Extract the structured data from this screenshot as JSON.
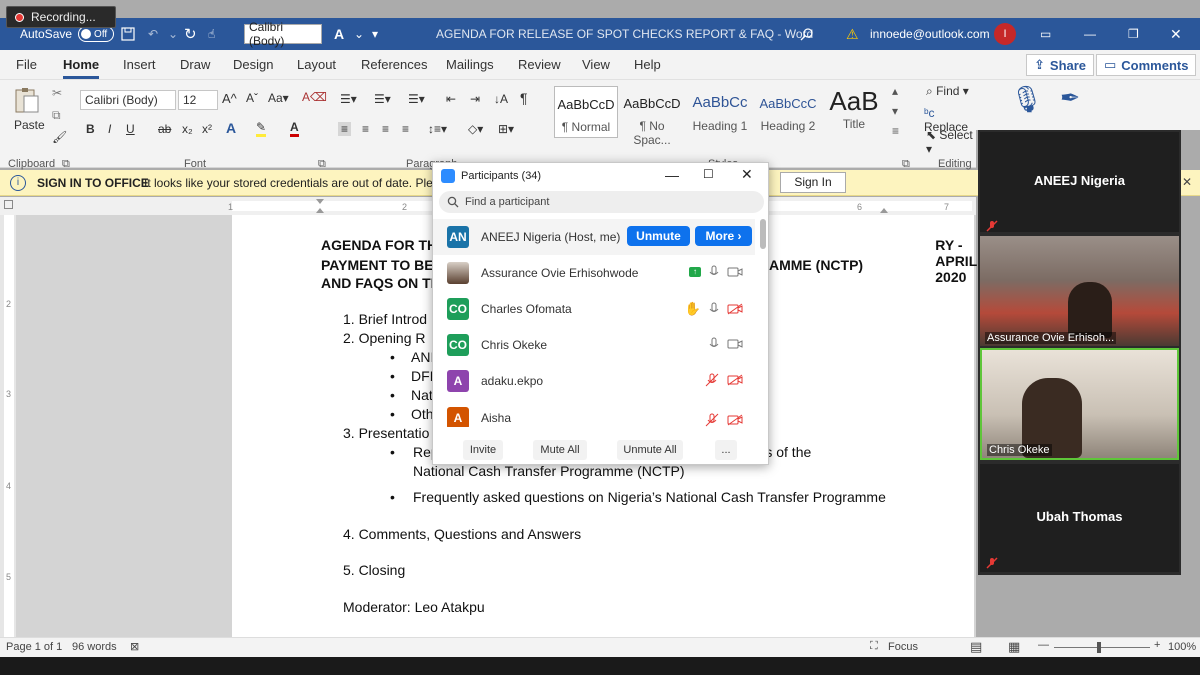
{
  "recording": "Recording...",
  "titlebar": {
    "autosave": "AutoSave",
    "autosave_state": "Off",
    "font_name": "Calibri (Body)",
    "doc_title": "AGENDA FOR RELEASE OF SPOT CHECKS REPORT & FAQ  -  Word",
    "account": "innoede@outlook.com",
    "avatar_letter": "I"
  },
  "menu": {
    "tabs": [
      "File",
      "Home",
      "Insert",
      "Draw",
      "Design",
      "Layout",
      "References",
      "Mailings",
      "Review",
      "View",
      "Help"
    ],
    "share": "Share",
    "comments": "Comments"
  },
  "ribbon": {
    "paste": "Paste",
    "font_name": "Calibri (Body)",
    "font_size": "12",
    "clipboard": "Clipboard",
    "font_group": "Font",
    "paragraph_group": "Paragraph",
    "styles_group": "Styles",
    "editing_group": "Editing",
    "styles": [
      {
        "sample": "AaBbCcD",
        "name": "¶ Normal"
      },
      {
        "sample": "AaBbCcD",
        "name": "¶ No Spac..."
      },
      {
        "sample": "AaBbCc",
        "name": "Heading 1"
      },
      {
        "sample": "AaBbCcC",
        "name": "Heading 2"
      },
      {
        "sample": "AaB",
        "name": "Title"
      }
    ],
    "find": "Find",
    "replace": "Replace",
    "select": "Select"
  },
  "infobar": {
    "title": "SIGN IN TO OFFICE",
    "message": "It looks like your stored credentials are out of date. Please",
    "button": "Sign In"
  },
  "document": {
    "heading_line1_left": "AGENDA FOR THE",
    "heading_line1_right": "RY - APRIL 2020",
    "heading_line2_left": "PAYMENT TO BEN",
    "heading_line2_right": "AMME (NCTP)",
    "heading_line3_left": "AND FAQS ON TH",
    "item1": "1.   Brief Introd",
    "item2": "2.   Opening R",
    "sub1": "ANI",
    "sub2": "DFI",
    "sub3": "Nat",
    "sub4": "Oth",
    "item3": "3.   Presentatio",
    "bullet_rep_left": "Rep",
    "bullet_rep_right": "aries of the",
    "bullet_rep_line2": "National Cash Transfer Programme (NCTP)",
    "bullet_faq": "Frequently asked questions on Nigeria’s National Cash Transfer Programme",
    "item4": "4.   Comments, Questions and Answers",
    "item5": "5.   Closing",
    "moderator": "Moderator: Leo Atakpu"
  },
  "statusbar": {
    "page": "Page 1 of 1",
    "words": "96 words",
    "focus": "Focus",
    "zoom": "100%"
  },
  "video": {
    "tile1": "ANEEJ Nigeria",
    "tile2": "Assurance Ovie Erhisoh...",
    "tile3": "Chris Okeke",
    "tile4": "Ubah Thomas"
  },
  "participants": {
    "title": "Participants (34)",
    "search_placeholder": "Find a participant",
    "rows": [
      {
        "initials": "AN",
        "name": "ANEEJ Nigeria (Host, me)",
        "color": "#1a73a8"
      },
      {
        "initials": "",
        "name": "Assurance Ovie Erhisohwode",
        "color": "#7a5a3a"
      },
      {
        "initials": "CO",
        "name": "Charles Ofomata",
        "color": "#1e9e5a"
      },
      {
        "initials": "CO",
        "name": "Chris Okeke",
        "color": "#1e9e5a"
      },
      {
        "initials": "A",
        "name": "adaku.ekpo",
        "color": "#8e44ad"
      },
      {
        "initials": "A",
        "name": "Aisha",
        "color": "#d35400"
      }
    ],
    "unmute": "Unmute",
    "more": "More ›",
    "invite": "Invite",
    "mute_all": "Mute All",
    "unmute_all": "Unmute All",
    "ellipsis": "..."
  }
}
